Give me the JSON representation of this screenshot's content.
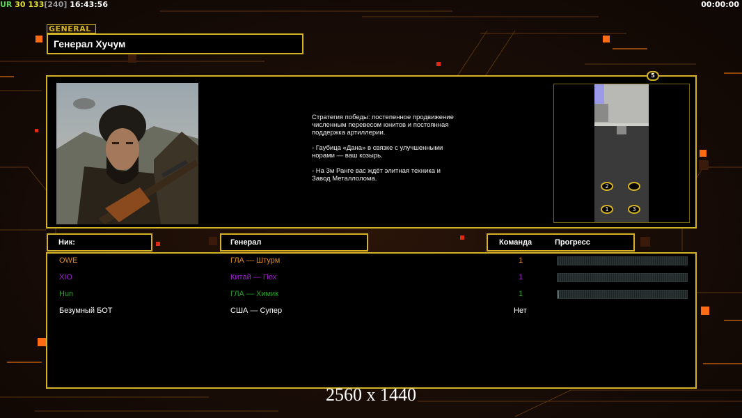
{
  "topbar": {
    "ur_label": "UR",
    "fps": "30",
    "frames": "133",
    "frames_cap": "[240]",
    "time": "16:43:56",
    "timer_right": "00:00:00"
  },
  "general": {
    "tag": "GENERAL",
    "name": "Генерал Хучум"
  },
  "strategy": {
    "lines": [
      "Стратегия победы: постепенное продвижение численным перевесом юнитов и постоянная поддержка артиллерии.",
      "- Гаубица «Дана» в связке с улучшенными норами — ваш козырь.",
      "- На 3м Ранге вас ждёт элитная техника и Завод Металлолома."
    ]
  },
  "minimap": {
    "player_count": "5",
    "spawns": [
      "2",
      "",
      "1",
      "3"
    ]
  },
  "headers": {
    "nick": "Ник:",
    "general": "Генерал",
    "team": "Команда",
    "progress": "Прогресс"
  },
  "players": [
    {
      "nick": "OWE",
      "general": "ГЛА — Штурм",
      "team": "1",
      "progress": 0.0,
      "color": "#e08a2a"
    },
    {
      "nick": "XIO",
      "general": "Китай — Пех",
      "team": "1",
      "progress": 0.0,
      "color": "#a020d0"
    },
    {
      "nick": "Hun",
      "general": "ГЛА — Химик",
      "team": "1",
      "progress": 0.01,
      "color": "#2aa02a"
    },
    {
      "nick": "Безумный БОТ",
      "general": "США — Супер",
      "team": "Нет",
      "progress": null,
      "color": "#ffffff"
    }
  ],
  "resolution": "2560 x 1440",
  "colors": {
    "frame_gold": "#d4b326",
    "accent_orange": "#ff7a1a"
  }
}
